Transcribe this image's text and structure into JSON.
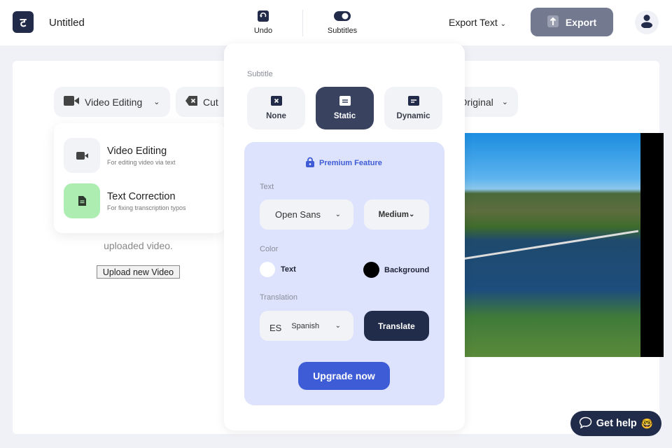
{
  "header": {
    "logo": "ट",
    "title": "Untitled",
    "undo": "Undo",
    "subtitles": "Subtitles",
    "export_text": "Export Text",
    "export": "Export"
  },
  "toolbar": {
    "mode": "Video Editing",
    "cut": "Cut",
    "original": "Original"
  },
  "mode_menu": {
    "items": [
      {
        "title": "Video Editing",
        "subtitle": "For editing video via text",
        "icon": "video-camera-icon"
      },
      {
        "title": "Text Correction",
        "subtitle": "For fixing transcription typos",
        "icon": "document-icon"
      }
    ]
  },
  "main": {
    "hint": "uploaded video.",
    "upload_button": "Upload new Video"
  },
  "subtitle_panel": {
    "label": "Subtitle",
    "options": [
      {
        "label": "None",
        "selected": false
      },
      {
        "label": "Static",
        "selected": true
      },
      {
        "label": "Dynamic",
        "selected": false
      }
    ],
    "premium": "Premium Feature",
    "text_label": "Text",
    "font": "Open Sans",
    "weight": "Medium",
    "color_label": "Color",
    "text_color_label": "Text",
    "text_color": "#ffffff",
    "bg_color_label": "Background",
    "bg_color": "#000000",
    "translation_label": "Translation",
    "lang_code": "ES",
    "language": "Spanish",
    "translate": "Translate",
    "upgrade": "Upgrade now"
  },
  "help": {
    "label": "Get help",
    "emoji": "🤓"
  },
  "colors": {
    "navy": "#212b4a",
    "accent": "#3e5cd6",
    "premium_bg": "#dde3fd",
    "export_bg": "#737a90"
  }
}
